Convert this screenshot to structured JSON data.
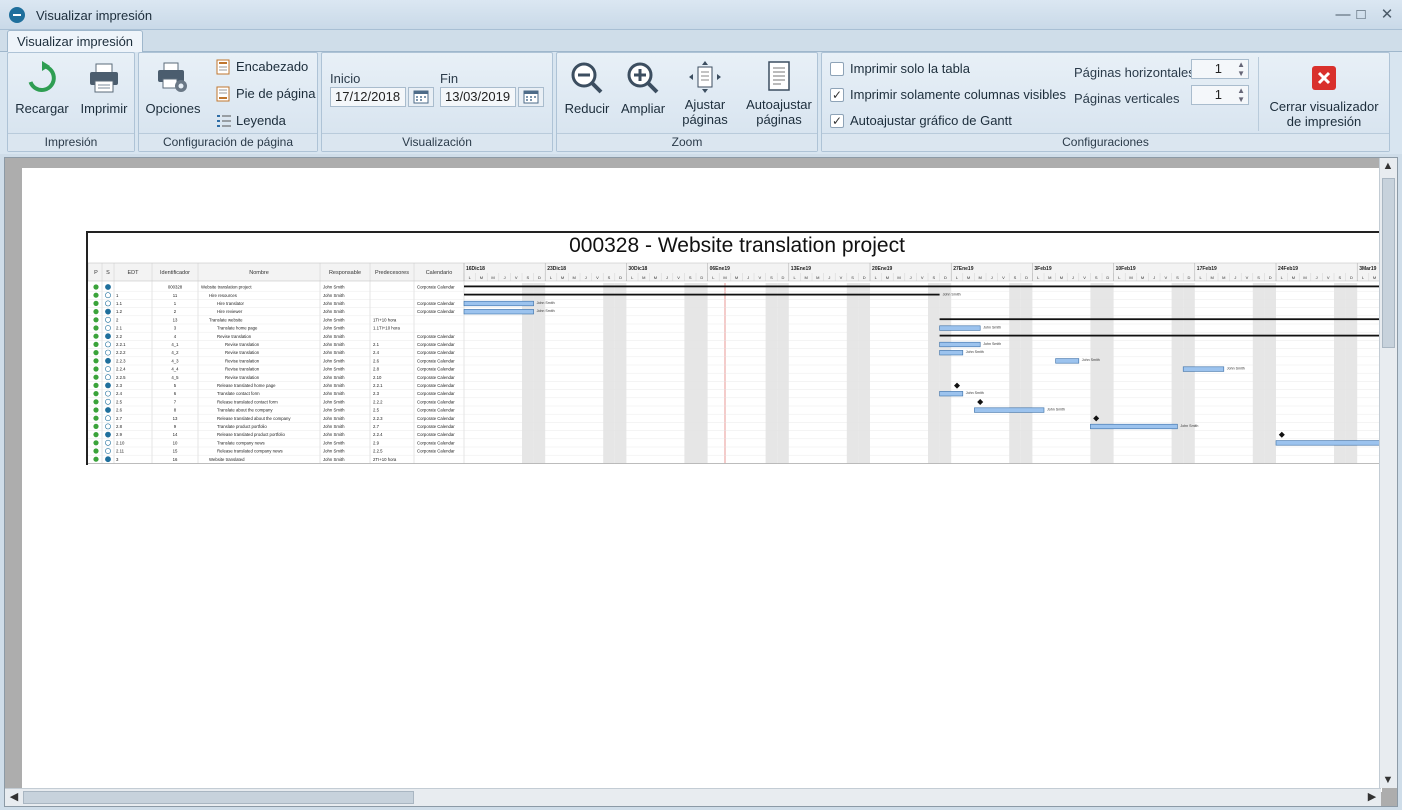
{
  "window": {
    "title": "Visualizar impresión"
  },
  "tabs": [
    {
      "label": "Visualizar impresión"
    }
  ],
  "groups": {
    "impresion": {
      "label": "Impresión",
      "recargar": "Recargar",
      "imprimir": "Imprimir"
    },
    "config_pagina": {
      "label": "Configuración de página",
      "opciones": "Opciones",
      "encabezado": "Encabezado",
      "pie": "Pie de página",
      "leyenda": "Leyenda"
    },
    "visualizacion": {
      "label": "Visualización",
      "inicio_label": "Inicio",
      "inicio_value": "17/12/2018",
      "fin_label": "Fin",
      "fin_value": "13/03/2019"
    },
    "zoom": {
      "label": "Zoom",
      "reducir": "Reducir",
      "ampliar": "Ampliar",
      "ajustar_l1": "Ajustar",
      "ajustar_l2": "páginas",
      "auto_l1": "Autoajustar",
      "auto_l2": "páginas"
    },
    "configuraciones": {
      "label": "Configuraciones",
      "chk_tabla": {
        "label": "Imprimir solo la tabla",
        "checked": false
      },
      "chk_columnas": {
        "label": "Imprimir solamente columnas visibles",
        "checked": true
      },
      "chk_gantt": {
        "label": "Autoajustar gráfico de Gantt",
        "checked": true
      },
      "pag_horiz_label": "Páginas horizontales",
      "pag_horiz_value": "1",
      "pag_vert_label": "Páginas verticales",
      "pag_vert_value": "1",
      "cerrar_l1": "Cerrar visualizador",
      "cerrar_l2": "de impresión"
    }
  },
  "colors": {
    "accent": "#1f6f9c",
    "bar_fill": "#9cc3ee",
    "bar_stroke": "#3a6ea5",
    "weekend": "#e6e6e6",
    "today_line": "#d9534f",
    "close_red": "#d9302c",
    "status_green": "#3aa33a"
  },
  "report": {
    "title": "000328 - Website translation project",
    "columns": [
      "P",
      "S",
      "EDT",
      "Identificador",
      "Nombre",
      "Responsable",
      "Predecesores",
      "Calendario"
    ],
    "weeks": [
      "16Dic18",
      "23Dic18",
      "30Dic18",
      "06Ene19",
      "13Ene19",
      "20Ene19",
      "27Ene19",
      "3Feb19",
      "10Feb19",
      "17Feb19",
      "24Feb19",
      "3Mar19"
    ],
    "day_letters": [
      "L",
      "M",
      "M",
      "J",
      "V",
      "S",
      "D"
    ],
    "rows": [
      {
        "edt": "",
        "id": "000328",
        "name": "Website translation project",
        "indent": 0,
        "resp": "John Smith",
        "pred": "",
        "cal": "Corporate Calendar"
      },
      {
        "edt": "1",
        "id": "11",
        "name": "Hire resources",
        "indent": 1,
        "resp": "John Smith",
        "pred": "",
        "cal": ""
      },
      {
        "edt": "1.1",
        "id": "1",
        "name": "Hire translator",
        "indent": 2,
        "resp": "John Smith",
        "pred": "",
        "cal": "Corporate Calendar"
      },
      {
        "edt": "1.2",
        "id": "2",
        "name": "Hire reviewer",
        "indent": 2,
        "resp": "John Smith",
        "pred": "",
        "cal": "Corporate Calendar"
      },
      {
        "edt": "2",
        "id": "13",
        "name": "Translate website",
        "indent": 1,
        "resp": "John Smith",
        "pred": "1TI+10 hora",
        "cal": ""
      },
      {
        "edt": "2.1",
        "id": "3",
        "name": "Translate home page",
        "indent": 2,
        "resp": "John Smith",
        "pred": "1.1TI+10 hora",
        "cal": ""
      },
      {
        "edt": "2.2",
        "id": "4",
        "name": "Revise translation",
        "indent": 2,
        "resp": "John Smith",
        "pred": "",
        "cal": "Corporate Calendar"
      },
      {
        "edt": "2.2.1",
        "id": "4_1",
        "name": "Revise translation",
        "indent": 3,
        "resp": "John Smith",
        "pred": "2.1",
        "cal": "Corporate Calendar"
      },
      {
        "edt": "2.2.2",
        "id": "4_2",
        "name": "Revise translation",
        "indent": 3,
        "resp": "John Smith",
        "pred": "2.4",
        "cal": "Corporate Calendar"
      },
      {
        "edt": "2.2.3",
        "id": "4_3",
        "name": "Revise translation",
        "indent": 3,
        "resp": "John Smith",
        "pred": "2.6",
        "cal": "Corporate Calendar"
      },
      {
        "edt": "2.2.4",
        "id": "4_4",
        "name": "Revise translation",
        "indent": 3,
        "resp": "John Smith",
        "pred": "2.8",
        "cal": "Corporate Calendar"
      },
      {
        "edt": "2.2.5",
        "id": "4_5",
        "name": "Revise translation",
        "indent": 3,
        "resp": "John Smith",
        "pred": "2.10",
        "cal": "Corporate Calendar"
      },
      {
        "edt": "2.3",
        "id": "5",
        "name": "Release translated home page",
        "indent": 2,
        "resp": "John Smith",
        "pred": "2.2.1",
        "cal": "Corporate Calendar"
      },
      {
        "edt": "2.4",
        "id": "6",
        "name": "Translate contact form",
        "indent": 2,
        "resp": "John Smith",
        "pred": "2.3",
        "cal": "Corporate Calendar"
      },
      {
        "edt": "2.5",
        "id": "7",
        "name": "Release translated contact form",
        "indent": 2,
        "resp": "John Smith",
        "pred": "2.2.2",
        "cal": "Corporate Calendar"
      },
      {
        "edt": "2.6",
        "id": "8",
        "name": "Translate about the company",
        "indent": 2,
        "resp": "John Smith",
        "pred": "2.5",
        "cal": "Corporate Calendar"
      },
      {
        "edt": "2.7",
        "id": "13",
        "name": "Release translated about the company",
        "indent": 2,
        "resp": "John Smith",
        "pred": "2.2.3",
        "cal": "Corporate Calendar"
      },
      {
        "edt": "2.8",
        "id": "9",
        "name": "Translate product portfolio",
        "indent": 2,
        "resp": "John Smith",
        "pred": "2.7",
        "cal": "Corporate Calendar"
      },
      {
        "edt": "2.9",
        "id": "14",
        "name": "Release translated product portfolio",
        "indent": 2,
        "resp": "John Smith",
        "pred": "2.2.4",
        "cal": "Corporate Calendar"
      },
      {
        "edt": "2.10",
        "id": "10",
        "name": "Translate company news",
        "indent": 2,
        "resp": "John Smith",
        "pred": "2.9",
        "cal": "Corporate Calendar"
      },
      {
        "edt": "2.11",
        "id": "15",
        "name": "Release translated company news",
        "indent": 2,
        "resp": "John Smith",
        "pred": "2.2.5",
        "cal": "Corporate Calendar"
      },
      {
        "edt": "3",
        "id": "16",
        "name": "Website translated",
        "indent": 1,
        "resp": "John Smith",
        "pred": "2TI+10 hora",
        "cal": ""
      }
    ],
    "bars": [
      {
        "row": 0,
        "kind": "summary",
        "start": 0,
        "end": 84,
        "label": ""
      },
      {
        "row": 1,
        "kind": "summary",
        "start": 0,
        "end": 41,
        "label": "John Smith"
      },
      {
        "row": 2,
        "kind": "task",
        "start": 0,
        "end": 6,
        "label": "John Smith"
      },
      {
        "row": 3,
        "kind": "task",
        "start": 0,
        "end": 6,
        "label": "John Smith"
      },
      {
        "row": 4,
        "kind": "summary",
        "start": 41,
        "end": 84,
        "label": "John Smith"
      },
      {
        "row": 5,
        "kind": "task",
        "start": 41,
        "end": 44.5,
        "label": "John Smith"
      },
      {
        "row": 6,
        "kind": "summary",
        "start": 41,
        "end": 89,
        "label": "John Smith"
      },
      {
        "row": 7,
        "kind": "task",
        "start": 41,
        "end": 44.5,
        "label": "John Smith"
      },
      {
        "row": 8,
        "kind": "task",
        "start": 41,
        "end": 43,
        "label": "John Smith"
      },
      {
        "row": 9,
        "kind": "task",
        "start": 51,
        "end": 53,
        "label": "John Smith"
      },
      {
        "row": 10,
        "kind": "task",
        "start": 62,
        "end": 65.5,
        "label": "John Smith"
      },
      {
        "row": 11,
        "kind": "task",
        "start": 81,
        "end": 90,
        "label": "John Smith"
      },
      {
        "row": 12,
        "kind": "milestone",
        "start": 42.5,
        "end": 42.5,
        "label": ""
      },
      {
        "row": 13,
        "kind": "task",
        "start": 41,
        "end": 43,
        "label": "John Smith"
      },
      {
        "row": 14,
        "kind": "milestone",
        "start": 44.5,
        "end": 44.5,
        "label": ""
      },
      {
        "row": 15,
        "kind": "task",
        "start": 44,
        "end": 50,
        "label": "John Smith"
      },
      {
        "row": 16,
        "kind": "milestone",
        "start": 54.5,
        "end": 54.5,
        "label": ""
      },
      {
        "row": 17,
        "kind": "task",
        "start": 54,
        "end": 61.5,
        "label": "John Smith"
      },
      {
        "row": 18,
        "kind": "milestone",
        "start": 70.5,
        "end": 70.5,
        "label": ""
      },
      {
        "row": 19,
        "kind": "task",
        "start": 70,
        "end": 80.5,
        "label": "John Smith"
      },
      {
        "row": 20,
        "kind": "milestone",
        "start": 91.5,
        "end": 91.5,
        "label": ""
      },
      {
        "row": 21,
        "kind": "milestone",
        "start": 91.5,
        "end": 91.5,
        "label": ""
      }
    ]
  }
}
